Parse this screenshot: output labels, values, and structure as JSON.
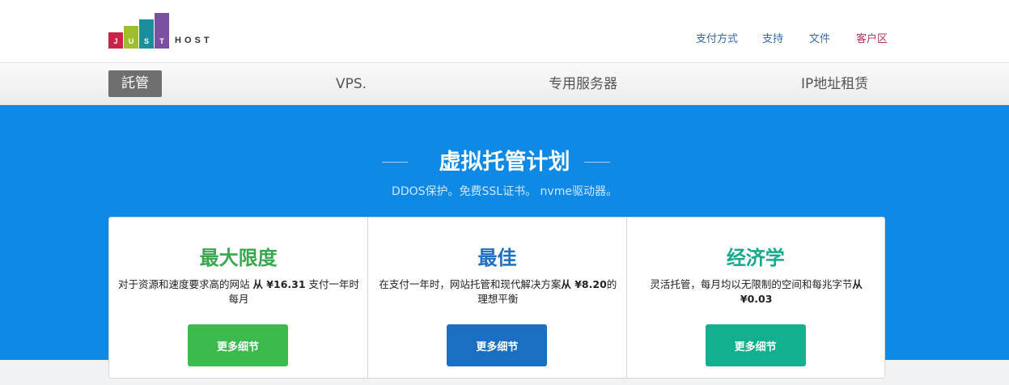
{
  "logo": {
    "letters": [
      "J",
      "U",
      "S",
      "T"
    ],
    "host": "HOST"
  },
  "toplinks": [
    "支付方式",
    "支持",
    "文件",
    "客户区"
  ],
  "nav": [
    "託管",
    "VPS.",
    "专用服务器",
    "IP地址租赁"
  ],
  "hero": {
    "title": "虚拟托管计划",
    "subtitle": "DDOS保护。免费SSL证书。 nvme驱动器。"
  },
  "plans": [
    {
      "title": "最大限度",
      "desc_pre": "对于资源和速度要求高的网站 ",
      "price": "从 ¥16.31",
      "desc_post": " 支付一年时每月",
      "button": "更多细节",
      "title_color": "#3aa650",
      "button_color": "#3dba4e"
    },
    {
      "title": "最佳",
      "desc_pre": "在支付一年时，网站托管和现代解决方案",
      "price": "从 ¥8.20",
      "desc_post": "的理想平衡",
      "button": "更多细节",
      "title_color": "#1f6fbf",
      "button_color": "#1a6fc2"
    },
    {
      "title": "经济学",
      "desc_pre": "灵活托管，每月均以无限制的空间和每兆字节",
      "price": "从 ¥0.03",
      "desc_post": "",
      "button": "更多细节",
      "title_color": "#16a98b",
      "button_color": "#12b08f"
    }
  ]
}
